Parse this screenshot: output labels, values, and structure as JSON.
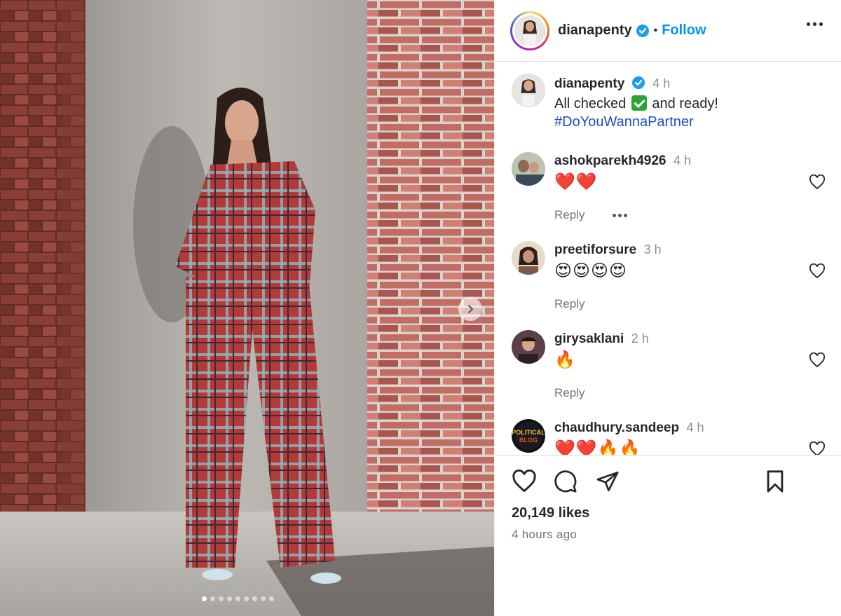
{
  "post": {
    "username": "dianapenty",
    "separator": "•",
    "follow_label": "Follow",
    "caption": {
      "username": "dianapenty",
      "time": "4 h",
      "text_before": "All checked",
      "text_after": "and ready!",
      "hashtag": "#DoYouWannaPartner"
    },
    "comments": [
      {
        "username": "ashokparekh4926",
        "time": "4 h",
        "emojis": "❤️❤️",
        "reply": "Reply",
        "has_more": true
      },
      {
        "username": "preetiforsure",
        "time": "3 h",
        "emojis": "😍😍😍😍",
        "reply": "Reply",
        "has_more": false
      },
      {
        "username": "girysaklani",
        "time": "2 h",
        "emojis": "🔥",
        "reply": "Reply",
        "has_more": false
      },
      {
        "username": "chaudhury.sandeep",
        "time": "4 h",
        "emojis": "❤️❤️🔥🔥",
        "reply": "",
        "has_more": false
      }
    ],
    "avatar_text": "POLITICAL BLOG",
    "likes": "20,149 likes",
    "time_ago": "4 hours ago",
    "carousel": {
      "count": 9,
      "active": 0
    }
  },
  "colors": {
    "follow": "#0095f6",
    "hashtag": "#1d4fbd",
    "verified": "#1d9bf0",
    "plaid": "#b33a36"
  },
  "icons": [
    "verified-icon",
    "more-icon",
    "heart-icon",
    "comment-icon",
    "share-icon",
    "bookmark-icon",
    "chevron-right-icon"
  ]
}
